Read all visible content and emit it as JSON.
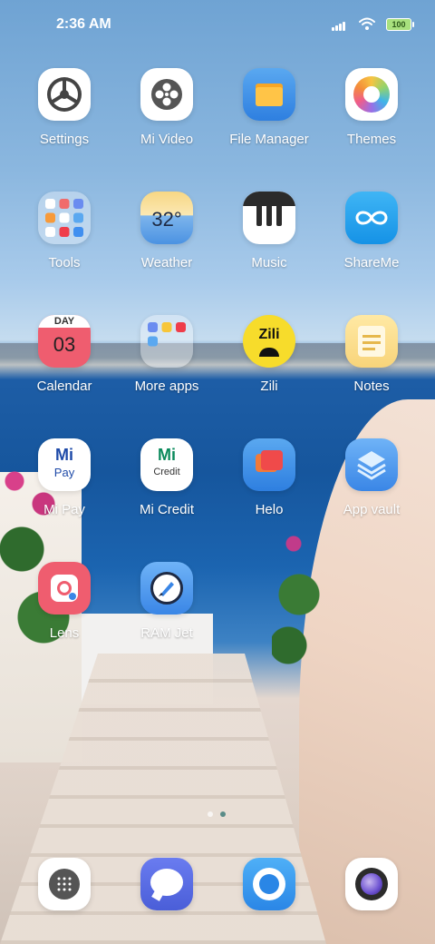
{
  "status_bar": {
    "time": "2:36 AM",
    "battery": "100"
  },
  "apps": [
    {
      "label": "Settings",
      "icon": "settings-gear-icon"
    },
    {
      "label": "Mi Video",
      "icon": "film-reel-icon"
    },
    {
      "label": "File Manager",
      "icon": "folder-icon"
    },
    {
      "label": "Themes",
      "icon": "color-wheel-icon"
    },
    {
      "label": "Tools",
      "icon": "folder-grid-icon"
    },
    {
      "label": "Weather",
      "icon": "weather-icon",
      "text": "32°"
    },
    {
      "label": "Music",
      "icon": "piano-keys-icon"
    },
    {
      "label": "ShareMe",
      "icon": "infinity-icon"
    },
    {
      "label": "Calendar",
      "icon": "calendar-icon",
      "day_label": "DAY",
      "date": "03"
    },
    {
      "label": "More apps",
      "icon": "folder-grid-icon"
    },
    {
      "label": "Zili",
      "icon": "zili-logo-icon",
      "text": "Zili"
    },
    {
      "label": "Notes",
      "icon": "notepad-icon"
    },
    {
      "label": "Mi Pay",
      "icon": "mipay-logo-icon",
      "text_top": "Mi",
      "text_bottom": "Pay"
    },
    {
      "label": "Mi Credit",
      "icon": "micredit-logo-icon",
      "text_top": "Mi",
      "text_bottom": "Credit"
    },
    {
      "label": "Helo",
      "icon": "chat-bubble-icon"
    },
    {
      "label": "App vault",
      "icon": "layers-icon"
    },
    {
      "label": "Lens",
      "icon": "lens-icon"
    },
    {
      "label": "RAM Jet",
      "icon": "rocket-icon"
    }
  ],
  "dock": [
    {
      "icon": "dialer-keypad-icon"
    },
    {
      "icon": "messaging-bubble-icon"
    },
    {
      "icon": "browser-bubble-icon"
    },
    {
      "icon": "camera-lens-icon"
    }
  ],
  "page_indicator": {
    "pages": 2,
    "current": 2
  },
  "colors": {
    "label_text": "#ffffff",
    "calendar_red": "#ef5d6f",
    "accent_blue": "#2e7fe0"
  }
}
